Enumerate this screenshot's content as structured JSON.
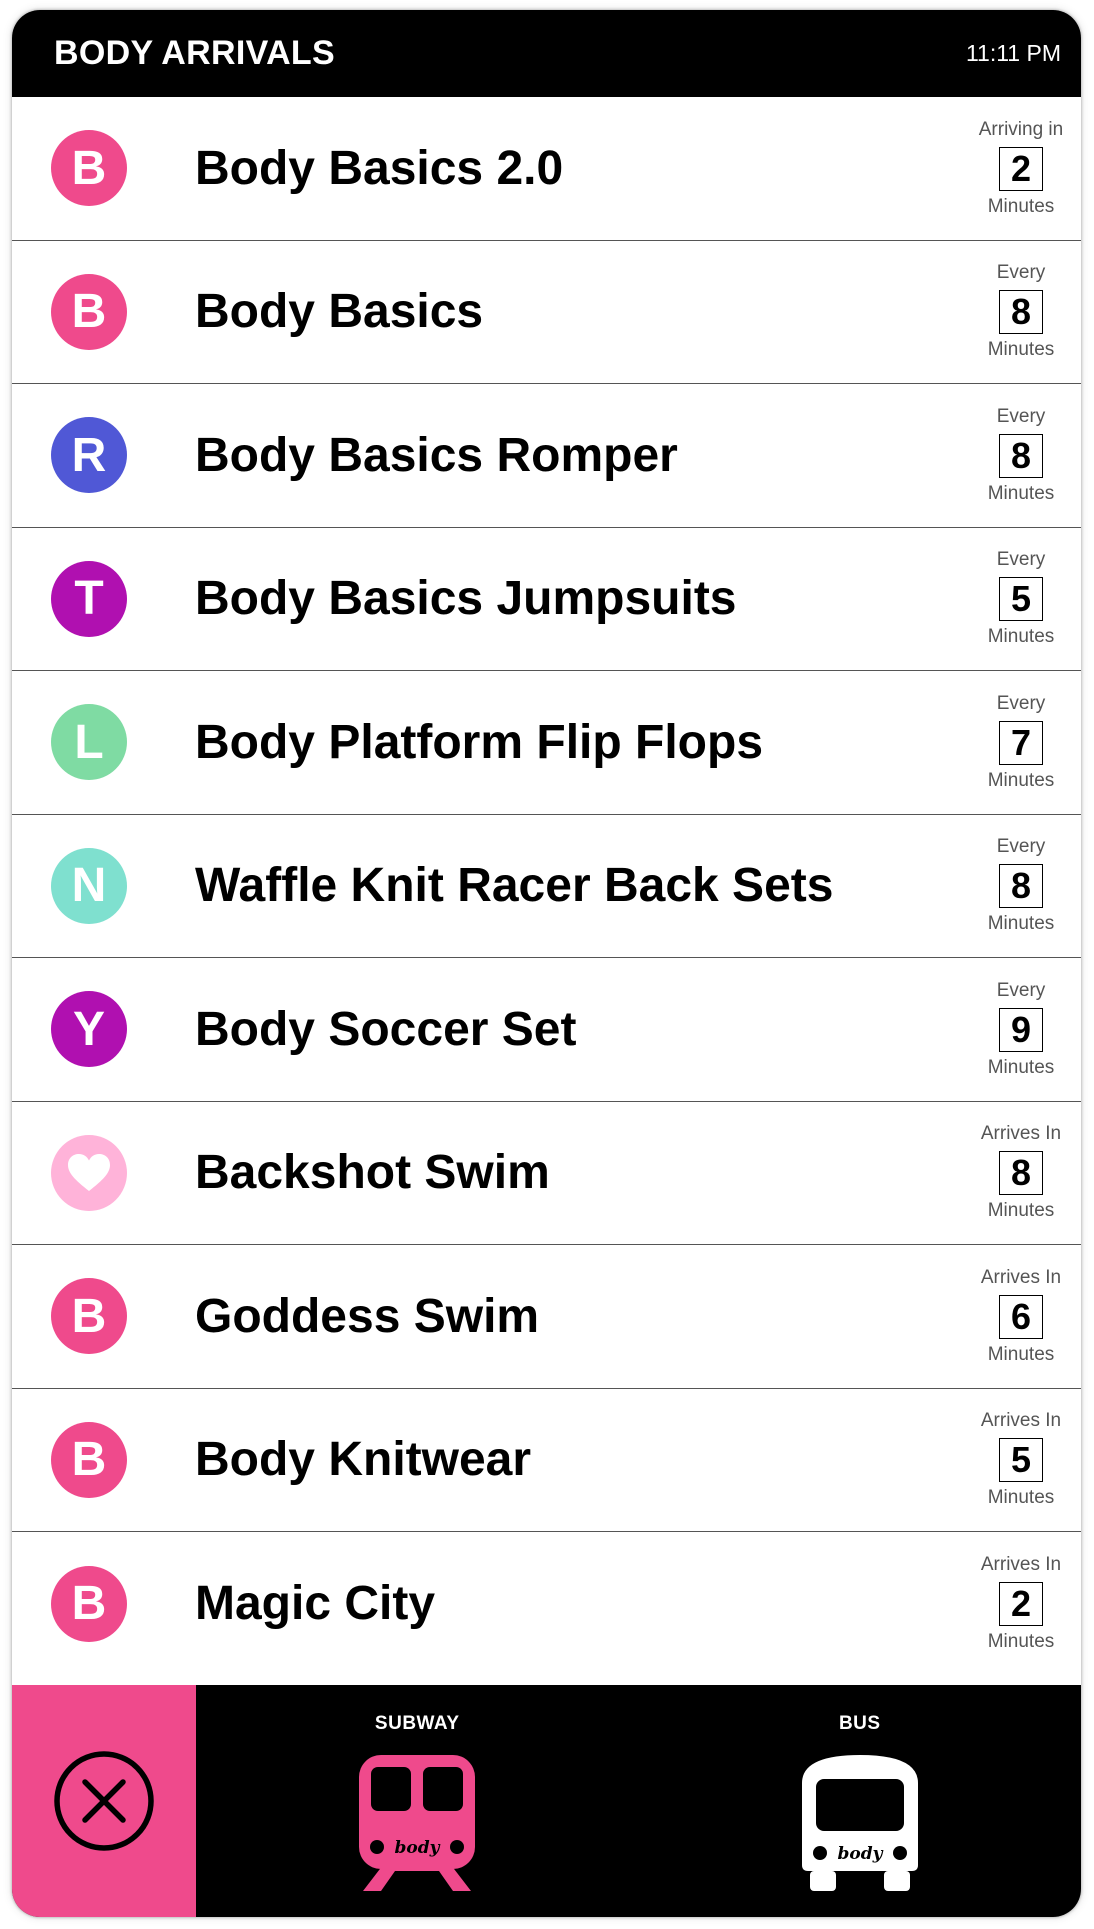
{
  "header": {
    "title": "BODY ARRIVALS",
    "time": "11:11 PM"
  },
  "rows": [
    {
      "badge": "B",
      "badge_color": "#ef4a8c",
      "name": "Body Basics 2.0",
      "label": "Arriving in",
      "value": "2",
      "unit": "Minutes"
    },
    {
      "badge": "B",
      "badge_color": "#ef4a8c",
      "name": "Body Basics",
      "label": "Every",
      "value": "8",
      "unit": "Minutes"
    },
    {
      "badge": "R",
      "badge_color": "#5058d6",
      "name": "Body Basics Romper",
      "label": "Every",
      "value": "8",
      "unit": "Minutes"
    },
    {
      "badge": "T",
      "badge_color": "#b010b0",
      "name": "Body Basics Jumpsuits",
      "label": "Every",
      "value": "5",
      "unit": "Minutes"
    },
    {
      "badge": "L",
      "badge_color": "#7fdba3",
      "name": "Body Platform Flip Flops",
      "label": "Every",
      "value": "7",
      "unit": "Minutes"
    },
    {
      "badge": "N",
      "badge_color": "#7fe0cf",
      "name": "Waffle Knit Racer Back Sets",
      "label": "Every",
      "value": "8",
      "unit": "Minutes"
    },
    {
      "badge": "Y",
      "badge_color": "#b010b0",
      "name": "Body Soccer Set",
      "label": "Every",
      "value": "9",
      "unit": "Minutes"
    },
    {
      "badge": "",
      "badge_icon": "heart-icon",
      "badge_color": "#ffb3d9",
      "name": "Backshot Swim",
      "label": "Arrives In",
      "value": "8",
      "unit": "Minutes"
    },
    {
      "badge": "B",
      "badge_color": "#ef4a8c",
      "name": "Goddess Swim",
      "label": "Arrives In",
      "value": "6",
      "unit": "Minutes"
    },
    {
      "badge": "B",
      "badge_color": "#ef4a8c",
      "name": "Body Knitwear",
      "label": "Arrives In",
      "value": "5",
      "unit": "Minutes"
    },
    {
      "badge": "B",
      "badge_color": "#ef4a8c",
      "name": "Magic City",
      "label": "Arrives In",
      "value": "2",
      "unit": "Minutes"
    }
  ],
  "footer": {
    "close_icon": "close-icon",
    "subway_label": "SUBWAY",
    "subway_icon": "subway-train-icon",
    "bus_label": "BUS",
    "bus_icon": "bus-icon",
    "vehicle_text": "body",
    "accent_color": "#ef4a8c"
  }
}
